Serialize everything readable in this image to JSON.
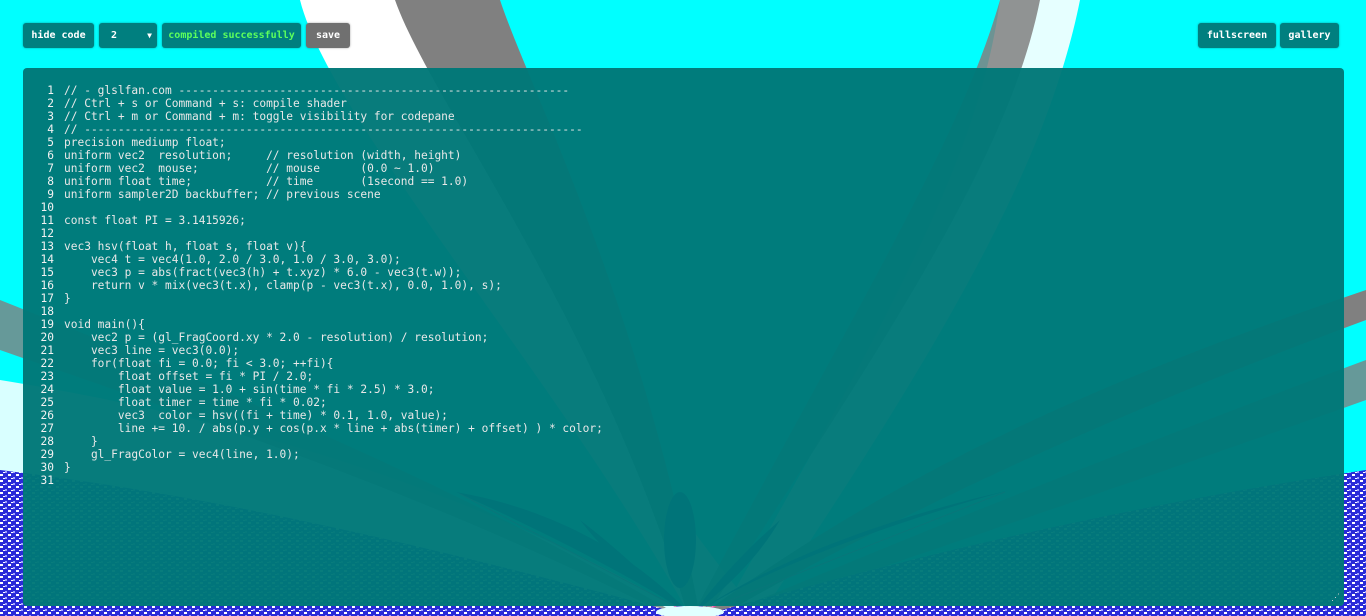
{
  "colors": {
    "background": "#00ffff",
    "code_pane": "#007878",
    "button": "#007f7f",
    "save_button": "#707070",
    "status_ok": "#5cff5c",
    "code_text": "#e8e8e8",
    "shader_gray": "#808080",
    "shader_navy": "#1a1aa6",
    "shader_blue": "#2020ff",
    "shader_pink": "#ff40a0"
  },
  "toolbar": {
    "hide_code_label": "hide code",
    "mode_value": "2",
    "status_text": "compiled successfully",
    "save_label": "save",
    "fullscreen_label": "fullscreen",
    "gallery_label": "gallery"
  },
  "icons": {
    "dropdown": "chevron-down-icon",
    "resize": "resize-grip-icon"
  },
  "editor": {
    "lines": [
      {
        "n": "1",
        "text": "// - glslfan.com ----------------------------------------------------------"
      },
      {
        "n": "2",
        "text": "// Ctrl + s or Command + s: compile shader"
      },
      {
        "n": "3",
        "text": "// Ctrl + m or Command + m: toggle visibility for codepane"
      },
      {
        "n": "4",
        "text": "// --------------------------------------------------------------------------"
      },
      {
        "n": "5",
        "text": "precision mediump float;"
      },
      {
        "n": "6",
        "text": "uniform vec2  resolution;     // resolution (width, height)"
      },
      {
        "n": "7",
        "text": "uniform vec2  mouse;          // mouse      (0.0 ~ 1.0)"
      },
      {
        "n": "8",
        "text": "uniform float time;           // time       (1second == 1.0)"
      },
      {
        "n": "9",
        "text": "uniform sampler2D backbuffer; // previous scene"
      },
      {
        "n": "10",
        "text": ""
      },
      {
        "n": "11",
        "text": "const float PI = 3.1415926;"
      },
      {
        "n": "12",
        "text": ""
      },
      {
        "n": "13",
        "text": "vec3 hsv(float h, float s, float v){"
      },
      {
        "n": "14",
        "text": "    vec4 t = vec4(1.0, 2.0 / 3.0, 1.0 / 3.0, 3.0);"
      },
      {
        "n": "15",
        "text": "    vec3 p = abs(fract(vec3(h) + t.xyz) * 6.0 - vec3(t.w));"
      },
      {
        "n": "16",
        "text": "    return v * mix(vec3(t.x), clamp(p - vec3(t.x), 0.0, 1.0), s);"
      },
      {
        "n": "17",
        "text": "}"
      },
      {
        "n": "18",
        "text": ""
      },
      {
        "n": "19",
        "text": "void main(){"
      },
      {
        "n": "20",
        "text": "    vec2 p = (gl_FragCoord.xy * 2.0 - resolution) / resolution;"
      },
      {
        "n": "21",
        "text": "    vec3 line = vec3(0.0);"
      },
      {
        "n": "22",
        "text": "    for(float fi = 0.0; fi < 3.0; ++fi){"
      },
      {
        "n": "23",
        "text": "        float offset = fi * PI / 2.0;"
      },
      {
        "n": "24",
        "text": "        float value = 1.0 + sin(time * fi * 2.5) * 3.0;"
      },
      {
        "n": "25",
        "text": "        float timer = time * fi * 0.02;"
      },
      {
        "n": "26",
        "text": "        vec3  color = hsv((fi + time) * 0.1, 1.0, value);"
      },
      {
        "n": "27",
        "text": "        line += 10. / abs(p.y + cos(p.x * line + abs(timer) + offset) ) * color;"
      },
      {
        "n": "28",
        "text": "    }"
      },
      {
        "n": "29",
        "text": "    gl_FragColor = vec4(line, 1.0);"
      },
      {
        "n": "30",
        "text": "}"
      },
      {
        "n": "31",
        "text": ""
      }
    ]
  }
}
